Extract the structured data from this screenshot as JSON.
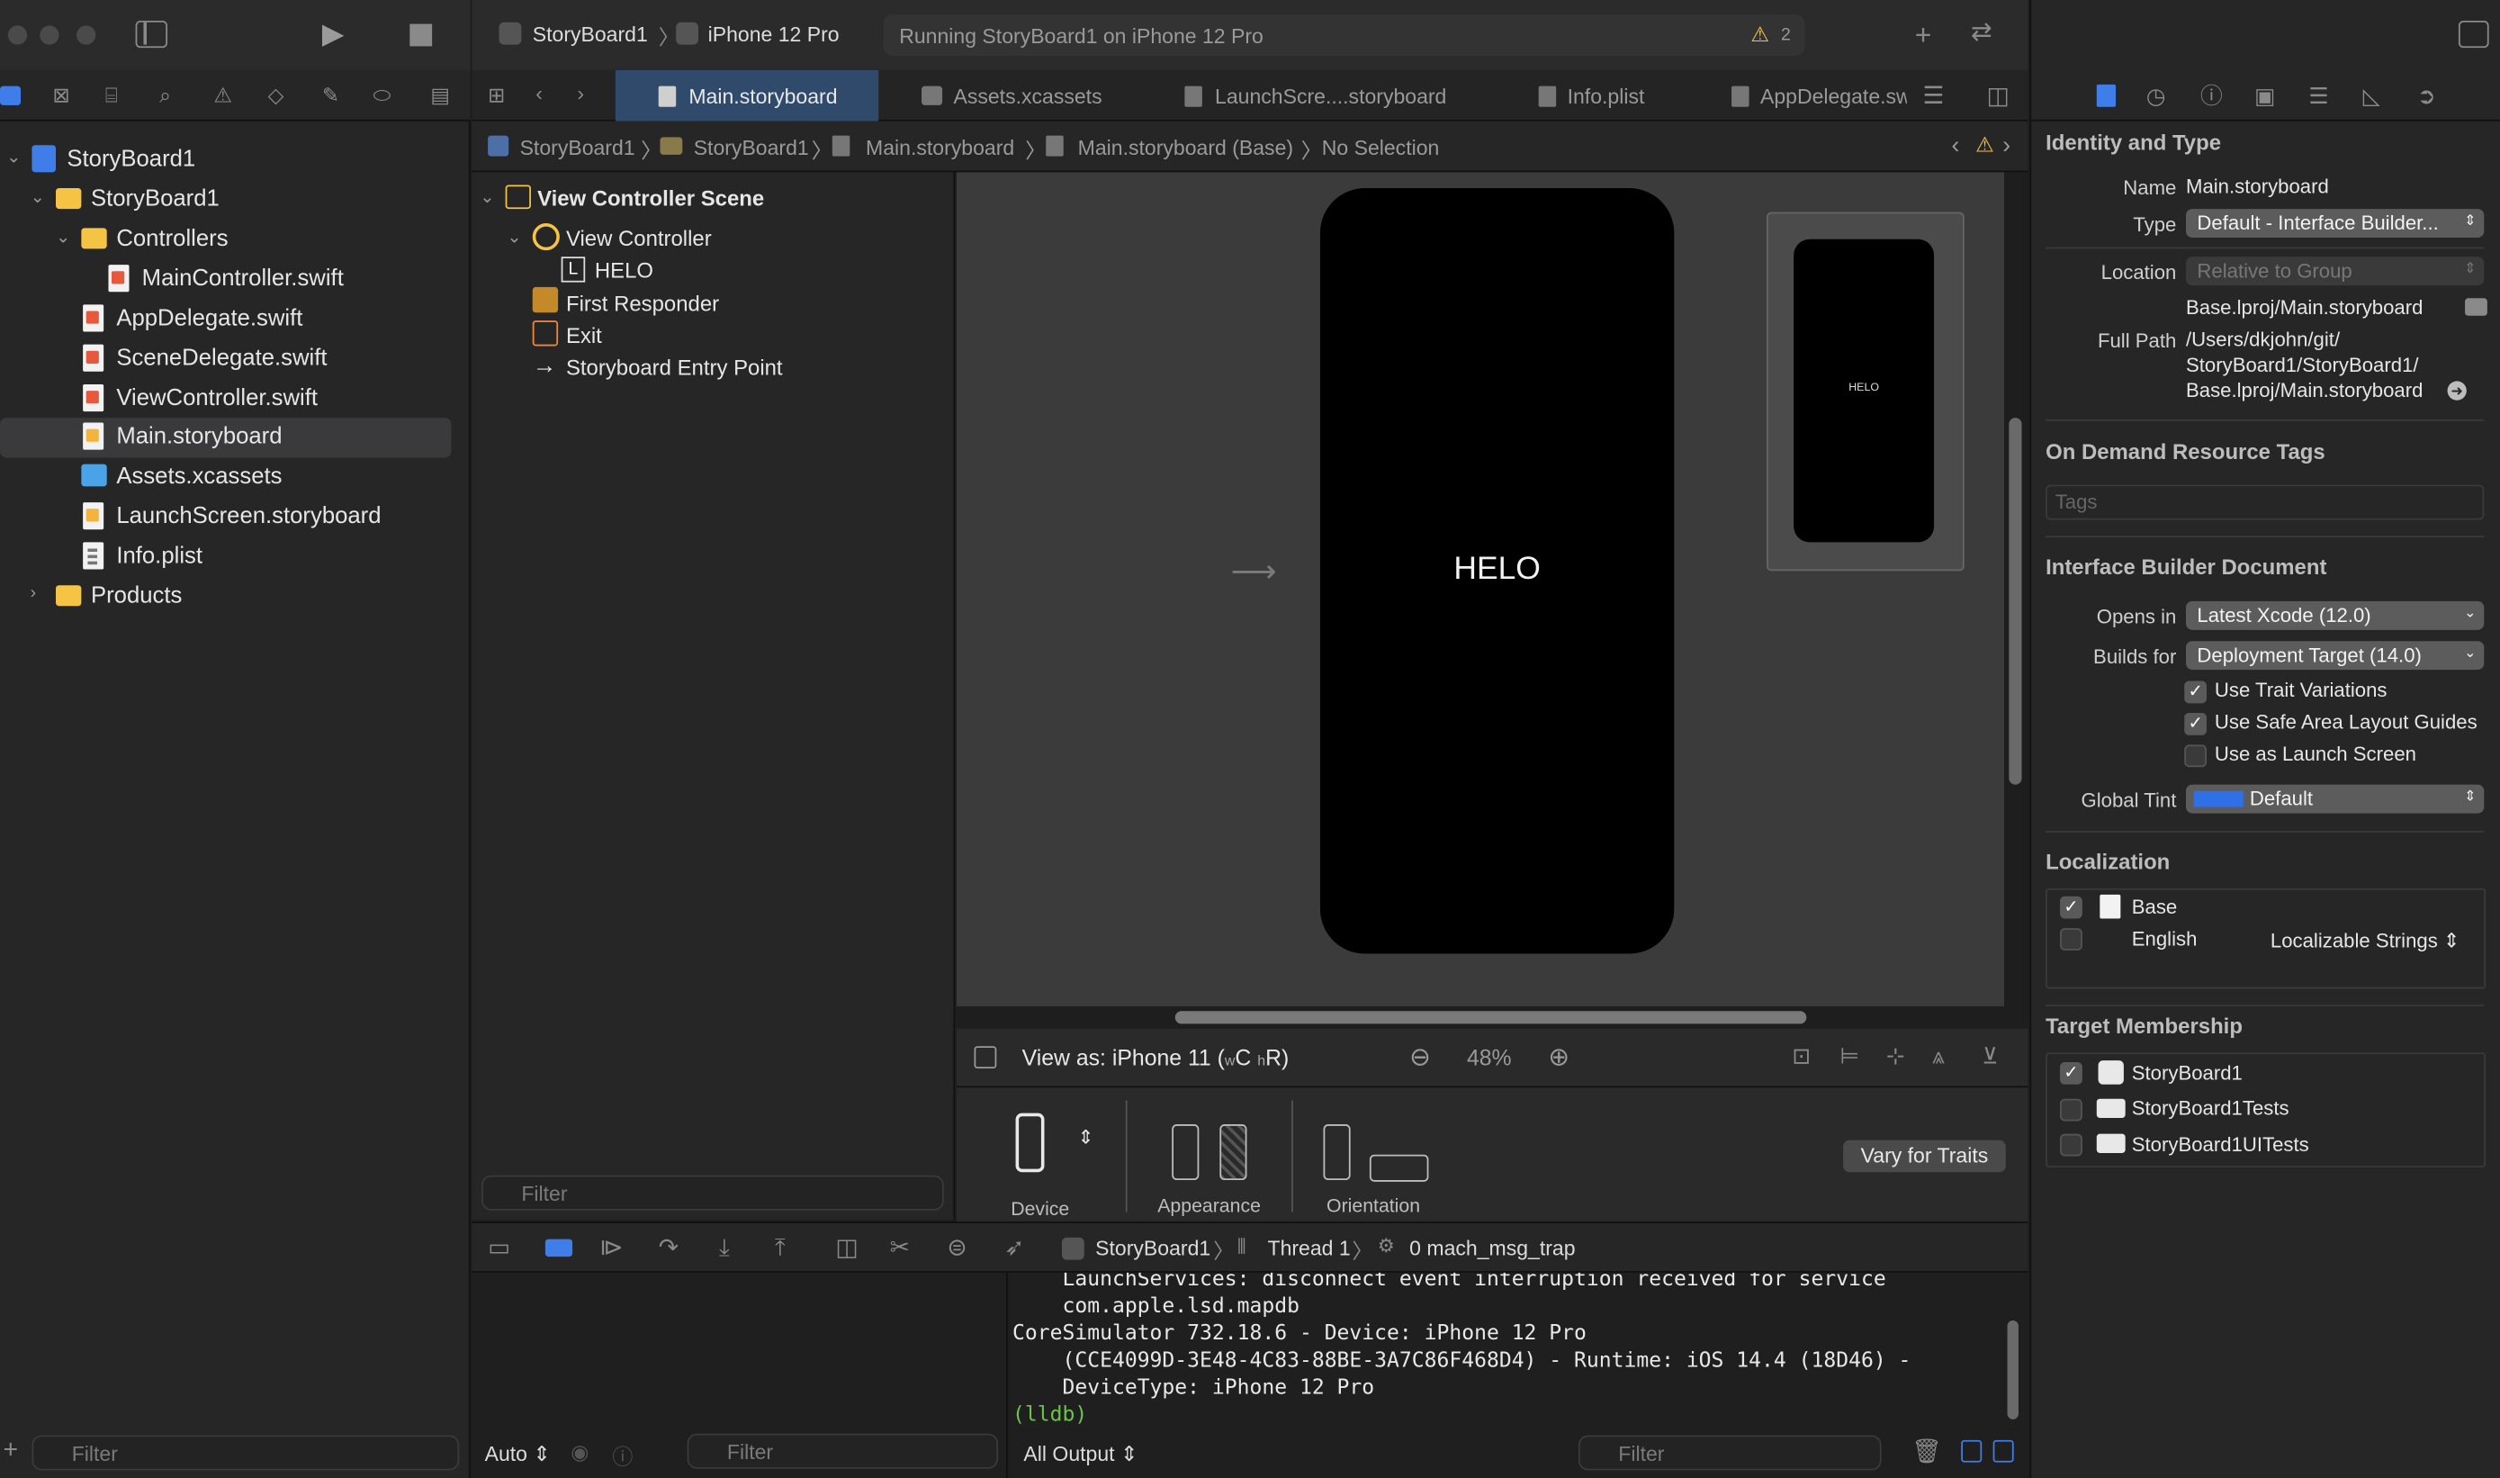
{
  "toolbar": {
    "scheme": "StoryBoard1",
    "device": "iPhone 12 Pro",
    "status": "Running StoryBoard1 on iPhone 12 Pro",
    "warning_count": "2"
  },
  "tabs": [
    {
      "label": "Main.storyboard",
      "active": true
    },
    {
      "label": "Assets.xcassets"
    },
    {
      "label": "LaunchScre....storyboard"
    },
    {
      "label": "Info.plist"
    },
    {
      "label": "AppDelegate.sw"
    }
  ],
  "jumpbar": [
    "StoryBoard1",
    "StoryBoard1",
    "Main.storyboard",
    "Main.storyboard (Base)",
    "No Selection"
  ],
  "navigator": {
    "items": [
      {
        "label": "StoryBoard1",
        "kind": "project"
      },
      {
        "label": "StoryBoard1",
        "kind": "folder"
      },
      {
        "label": "Controllers",
        "kind": "folder"
      },
      {
        "label": "MainController.swift",
        "kind": "swift"
      },
      {
        "label": "AppDelegate.swift",
        "kind": "swift"
      },
      {
        "label": "SceneDelegate.swift",
        "kind": "swift"
      },
      {
        "label": "ViewController.swift",
        "kind": "swift"
      },
      {
        "label": "Main.storyboard",
        "kind": "storyboard",
        "selected": true
      },
      {
        "label": "Assets.xcassets",
        "kind": "assets"
      },
      {
        "label": "LaunchScreen.storyboard",
        "kind": "storyboard"
      },
      {
        "label": "Info.plist",
        "kind": "plist"
      },
      {
        "label": "Products",
        "kind": "folder"
      }
    ],
    "filter_placeholder": "Filter"
  },
  "outline": {
    "scene": "View Controller Scene",
    "view_controller": "View Controller",
    "label_badge": "L",
    "label": "HELO",
    "first_responder": "First Responder",
    "exit": "Exit",
    "entry_point": "Storyboard Entry Point",
    "filter_placeholder": "Filter"
  },
  "canvas": {
    "label_text": "HELO",
    "mini_label": "HELO",
    "view_as_prefix": "View as: iPhone 11 (",
    "view_as_w": "w",
    "view_as_wc": "C",
    "view_as_h": "h",
    "view_as_hr": "R)",
    "zoom": "48%",
    "device_label": "Device",
    "appearance_label": "Appearance",
    "orientation_label": "Orientation",
    "vary_button": "Vary for Traits"
  },
  "debug": {
    "breadcrumb": [
      "StoryBoard1",
      "Thread 1",
      "0 mach_msg_trap"
    ],
    "console": [
      "    LaunchServices: disconnect event interruption received for service",
      "    com.apple.lsd.mapdb",
      "CoreSimulator 732.18.6 - Device: iPhone 12 Pro",
      "    (CCE4099D-3E48-4C83-88BE-3A7C86F468D4) - Runtime: iOS 14.4 (18D46) -",
      "    DeviceType: iPhone 12 Pro"
    ],
    "prompt": "(lldb)",
    "auto_label": "Auto",
    "output_label": "All Output",
    "filter_placeholder": "Filter"
  },
  "inspector": {
    "identity_title": "Identity and Type",
    "name_label": "Name",
    "name_value": "Main.storyboard",
    "type_label": "Type",
    "type_value": "Default - Interface Builder...",
    "location_label": "Location",
    "location_value": "Relative to Group",
    "location_path": "Base.lproj/Main.storyboard",
    "fullpath_label": "Full Path",
    "fullpath_lines": [
      "/Users/dkjohn/git/",
      "StoryBoard1/StoryBoard1/",
      "Base.lproj/Main.storyboard"
    ],
    "odr_title": "On Demand Resource Tags",
    "tags_placeholder": "Tags",
    "ib_title": "Interface Builder Document",
    "opens_in_label": "Opens in",
    "opens_in_value": "Latest Xcode (12.0)",
    "builds_for_label": "Builds for",
    "builds_for_value": "Deployment Target (14.0)",
    "checks": [
      {
        "label": "Use Trait Variations",
        "checked": true
      },
      {
        "label": "Use Safe Area Layout Guides",
        "checked": true
      },
      {
        "label": "Use as Launch Screen",
        "checked": false
      }
    ],
    "tint_label": "Global Tint",
    "tint_value": "Default",
    "tint_color": "#2f6fe8",
    "loc_title": "Localization",
    "localizations": [
      {
        "label": "Base",
        "checked": true,
        "extra": ""
      },
      {
        "label": "English",
        "checked": false,
        "extra": "Localizable Strings"
      }
    ],
    "target_title": "Target Membership",
    "targets": [
      {
        "label": "StoryBoard1",
        "checked": true
      },
      {
        "label": "StoryBoard1Tests",
        "checked": false
      },
      {
        "label": "StoryBoard1UITests",
        "checked": false
      }
    ]
  },
  "nav_filter_placeholder": "Filter",
  "colors": {
    "accent": "#2f6fe8",
    "warning": "#f5c445",
    "lldb": "#6cc24a"
  }
}
